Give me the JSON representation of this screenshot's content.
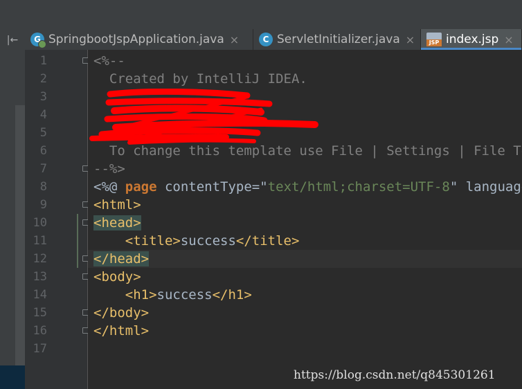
{
  "tabs": [
    {
      "label": "SpringbootJspApplication.java",
      "icon": "spring-boot-class-icon",
      "close": "×"
    },
    {
      "label": "ServletInitializer.java",
      "icon": "class-icon",
      "icon_letter": "C",
      "close": "×"
    },
    {
      "label": "index.jsp",
      "icon": "jsp-file-icon",
      "icon_letter": "JSP",
      "close": "×",
      "active": true
    }
  ],
  "toolstrip": {
    "collapse_glyph": "|←"
  },
  "line_numbers": [
    "1",
    "2",
    "3",
    "4",
    "5",
    "6",
    "7",
    "8",
    "9",
    "10",
    "11",
    "12",
    "13",
    "14",
    "15",
    "16",
    "17"
  ],
  "code": {
    "l1": "<%--",
    "l2": "  Created by IntelliJ IDEA.",
    "l6": "  To change this template use File | Settings | File Templates.",
    "l7": "--%>",
    "l8": {
      "open": "<%@ ",
      "kw": "page",
      "attr": " contentType=",
      "q1": "\"",
      "val": "text/html;charset=UTF-8",
      "q2": "\"",
      "rest": " language=\"java\" %>"
    },
    "l9": "<html>",
    "l10": "<head>",
    "l11": {
      "indent": "    ",
      "open": "<title>",
      "text": "success",
      "close": "</title>"
    },
    "l12": "</head>",
    "l13": "<body>",
    "l14": {
      "indent": "    ",
      "open": "<h1>",
      "text": "success",
      "close": "</h1>"
    },
    "l15": "</body>",
    "l16": "</html>"
  },
  "watermark": "https://blog.csdn.net/q845301261",
  "colors": {
    "comment": "#808080",
    "tag": "#e8bf6a",
    "keyword": "#cc7832",
    "string": "#6a8759",
    "redaction": "#ff0000"
  }
}
